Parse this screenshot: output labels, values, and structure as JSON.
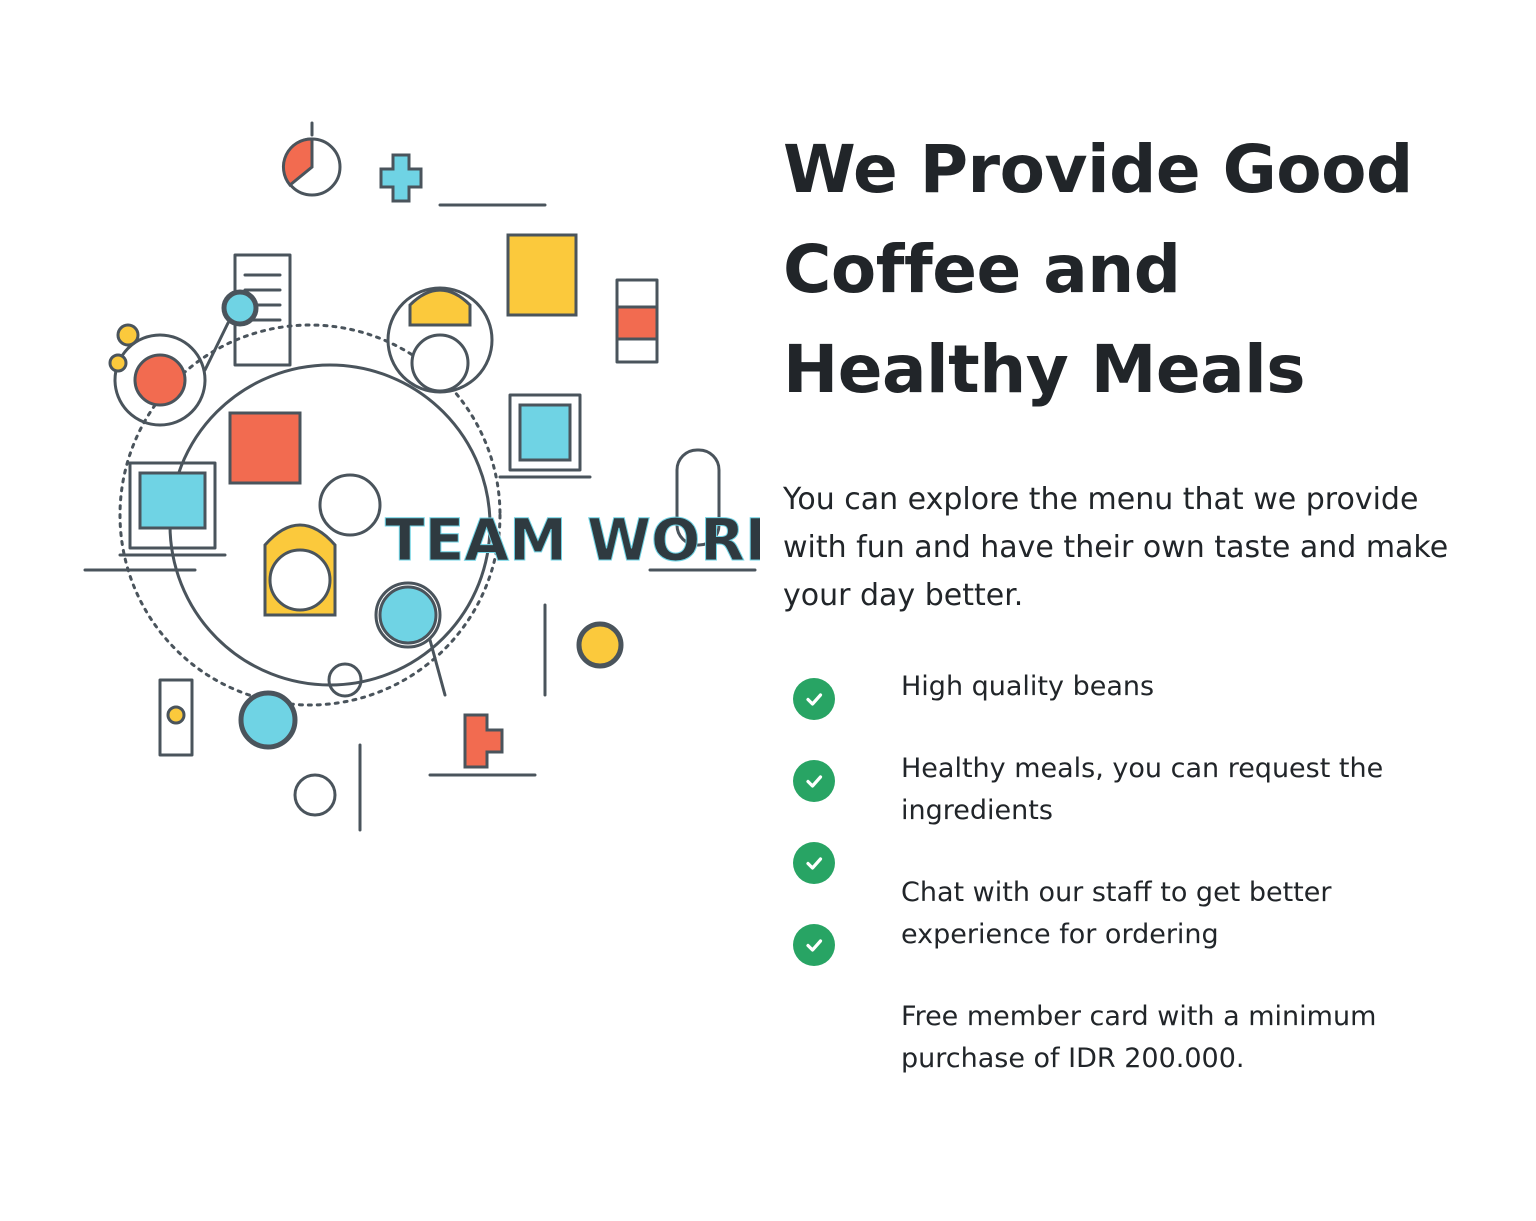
{
  "hero": {
    "illustration_label": "TEAM WORK",
    "illustration_icon": "team-work-illustration",
    "heading": "We Provide Good Coffee and Healthy Meals",
    "lead": "You can explore the menu that we provide with fun and have their own taste and make your day better.",
    "check_icon": "check-circle-icon",
    "check_color": "#28a464",
    "features": [
      "High quality beans",
      "Healthy meals, you can request the ingredients",
      "Chat with our staff to get better experience for ordering",
      "Free member card with a minimum purchase of IDR 200.000."
    ]
  },
  "colors": {
    "text": "#212529",
    "line_art": "#4a545c",
    "accent_orange": "#f26b50",
    "accent_yellow": "#fbc93c",
    "accent_cyan": "#6fd3e4"
  }
}
